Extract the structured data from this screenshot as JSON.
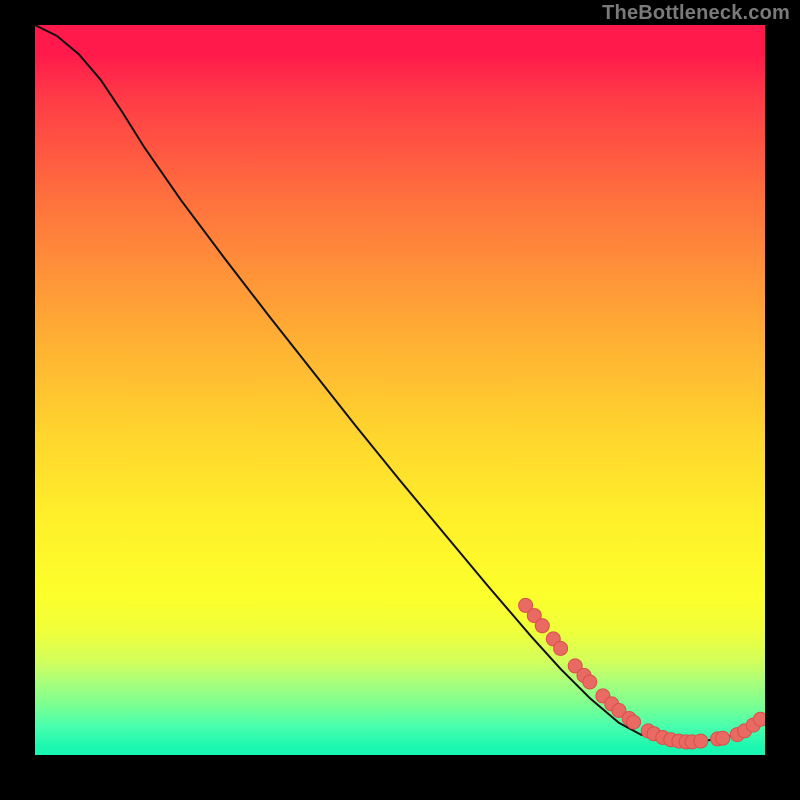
{
  "watermark": "TheBottleneck.com",
  "chart_data": {
    "type": "line",
    "title": "",
    "xlabel": "",
    "ylabel": "",
    "xlim": [
      0,
      1
    ],
    "ylim": [
      0,
      1
    ],
    "note": "Axes are unlabeled; coordinates are normalized 0-1 within the gradient plot area. y is fraction from the top edge (0 = top, 1 = bottom).",
    "curve": [
      {
        "x": 0.0,
        "y": 0.0
      },
      {
        "x": 0.03,
        "y": 0.015
      },
      {
        "x": 0.06,
        "y": 0.04
      },
      {
        "x": 0.09,
        "y": 0.075
      },
      {
        "x": 0.12,
        "y": 0.12
      },
      {
        "x": 0.15,
        "y": 0.168
      },
      {
        "x": 0.2,
        "y": 0.24
      },
      {
        "x": 0.26,
        "y": 0.32
      },
      {
        "x": 0.32,
        "y": 0.398
      },
      {
        "x": 0.38,
        "y": 0.474
      },
      {
        "x": 0.44,
        "y": 0.55
      },
      {
        "x": 0.5,
        "y": 0.624
      },
      {
        "x": 0.56,
        "y": 0.696
      },
      {
        "x": 0.62,
        "y": 0.768
      },
      {
        "x": 0.68,
        "y": 0.838
      },
      {
        "x": 0.72,
        "y": 0.882
      },
      {
        "x": 0.76,
        "y": 0.922
      },
      {
        "x": 0.8,
        "y": 0.956
      },
      {
        "x": 0.83,
        "y": 0.972
      },
      {
        "x": 0.87,
        "y": 0.982
      },
      {
        "x": 0.91,
        "y": 0.982
      },
      {
        "x": 0.95,
        "y": 0.975
      },
      {
        "x": 0.978,
        "y": 0.962
      },
      {
        "x": 1.0,
        "y": 0.948
      }
    ],
    "markers": [
      {
        "x": 0.672,
        "y": 0.795
      },
      {
        "x": 0.684,
        "y": 0.809
      },
      {
        "x": 0.695,
        "y": 0.823
      },
      {
        "x": 0.71,
        "y": 0.841
      },
      {
        "x": 0.72,
        "y": 0.854
      },
      {
        "x": 0.74,
        "y": 0.878
      },
      {
        "x": 0.752,
        "y": 0.891
      },
      {
        "x": 0.76,
        "y": 0.9
      },
      {
        "x": 0.778,
        "y": 0.919
      },
      {
        "x": 0.79,
        "y": 0.93
      },
      {
        "x": 0.8,
        "y": 0.939
      },
      {
        "x": 0.814,
        "y": 0.95
      },
      {
        "x": 0.82,
        "y": 0.955
      },
      {
        "x": 0.84,
        "y": 0.967
      },
      {
        "x": 0.848,
        "y": 0.971
      },
      {
        "x": 0.86,
        "y": 0.976
      },
      {
        "x": 0.871,
        "y": 0.979
      },
      {
        "x": 0.882,
        "y": 0.981
      },
      {
        "x": 0.892,
        "y": 0.982
      },
      {
        "x": 0.9,
        "y": 0.982
      },
      {
        "x": 0.912,
        "y": 0.981
      },
      {
        "x": 0.935,
        "y": 0.978
      },
      {
        "x": 0.942,
        "y": 0.977
      },
      {
        "x": 0.962,
        "y": 0.972
      },
      {
        "x": 0.972,
        "y": 0.967
      },
      {
        "x": 0.984,
        "y": 0.959
      },
      {
        "x": 0.994,
        "y": 0.951
      }
    ],
    "colors": {
      "curve_stroke": "#111111",
      "marker_fill": "#e96a63",
      "marker_stroke": "#d94f49"
    }
  }
}
